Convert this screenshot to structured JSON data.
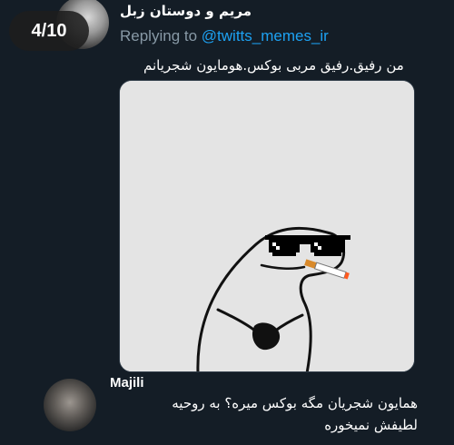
{
  "viewer": {
    "counter": "4/10"
  },
  "tweet": {
    "author_name": "مریم و دوستان زبل",
    "replying_prefix": "Replying to ",
    "replying_handle": "@twitts_memes_ir",
    "text": "من رفیق.رفیق مربی بوکس.هومایون شجریانم",
    "media": {
      "description_icon": "meme-drawing-sunglasses-cigarette"
    }
  },
  "reply": {
    "author_name": "Majili",
    "text_line1": "همایون شجریان مگه بوکس میره؟ به روحیه",
    "text_line2": "لطیفش نمیخوره"
  },
  "colors": {
    "background": "#141d26",
    "secondary_text": "#8899a6",
    "link": "#1da1f2"
  }
}
